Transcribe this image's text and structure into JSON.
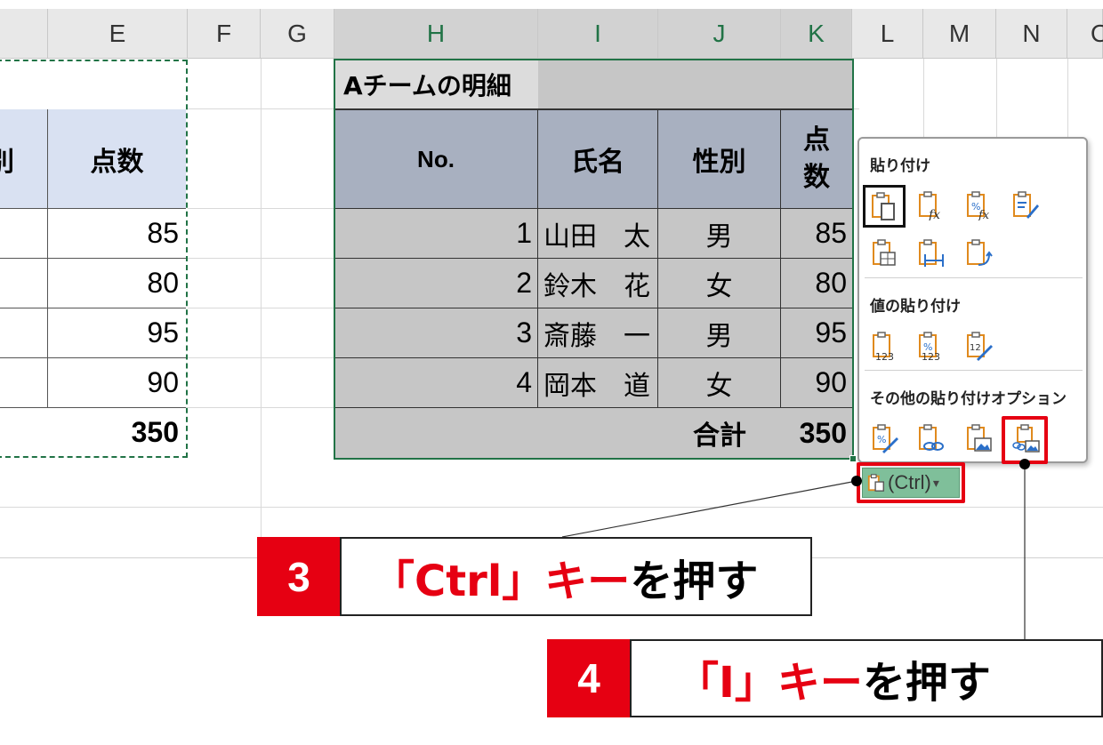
{
  "columns": [
    "E",
    "F",
    "G",
    "H",
    "I",
    "J",
    "K",
    "L",
    "M",
    "N",
    "O"
  ],
  "left_table": {
    "header_partial": "別",
    "header_score": "点数",
    "scores": [
      "85",
      "80",
      "95",
      "90"
    ],
    "total": "350"
  },
  "right_table": {
    "title": "Aチームの明細",
    "headers": {
      "no": "No.",
      "name": "氏名",
      "gender": "性別",
      "score_top": "点",
      "score_bottom": "数"
    },
    "rows": [
      {
        "no": "1",
        "name": "山田　太",
        "gender": "男",
        "score": "85"
      },
      {
        "no": "2",
        "name": "鈴木　花",
        "gender": "女",
        "score": "80"
      },
      {
        "no": "3",
        "name": "斎藤　一",
        "gender": "男",
        "score": "95"
      },
      {
        "no": "4",
        "name": "岡本　道",
        "gender": "女",
        "score": "90"
      }
    ],
    "total_label": "合計",
    "total_value": "350"
  },
  "paste_menu": {
    "section_paste": "貼り付け",
    "section_values": "値の貼り付け",
    "section_other": "その他の貼り付けオプション",
    "paste_icons": [
      "paste-icon",
      "paste-formulas-icon",
      "paste-formulas-number-format-icon",
      "paste-keep-source-format-icon",
      "paste-no-borders-icon",
      "paste-keep-column-widths-icon",
      "paste-transpose-icon"
    ],
    "value_icons": [
      "paste-values-icon",
      "paste-values-number-format-icon",
      "paste-values-source-format-icon"
    ],
    "other_icons": [
      "paste-formatting-icon",
      "paste-link-icon",
      "paste-picture-icon",
      "paste-linked-picture-icon"
    ]
  },
  "ctrl_button": {
    "label": "(Ctrl)",
    "arrow": "▾"
  },
  "callouts": [
    {
      "number": "3",
      "key": "「Ctrl」キー",
      "action": "を押す"
    },
    {
      "number": "4",
      "key": "「I」キー",
      "action": "を押す"
    }
  ],
  "colors": {
    "accent_red": "#e60012",
    "excel_green": "#217346",
    "selection_gray": "#c6c6c6"
  }
}
